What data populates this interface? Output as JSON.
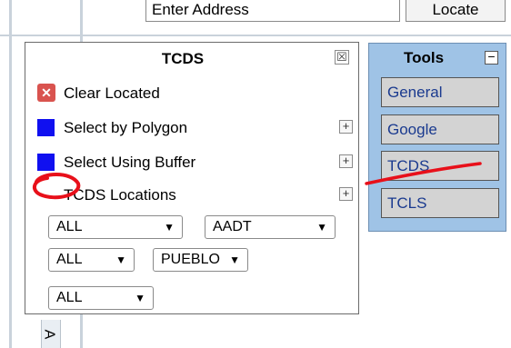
{
  "search": {
    "value": "Enter Address",
    "locate_label": "Locate"
  },
  "tcds_panel": {
    "title": "TCDS",
    "close_glyph": "☒",
    "clear_icon": "close-icon",
    "items": [
      {
        "label": "Clear Located"
      },
      {
        "label": "Select by Polygon"
      },
      {
        "label": "Select Using Buffer"
      },
      {
        "label": "TCDS Locations"
      }
    ],
    "expand_glyph": "+",
    "selects": [
      {
        "value": "ALL"
      },
      {
        "value": "AADT"
      },
      {
        "value": "ALL"
      },
      {
        "value": "PUEBLO"
      },
      {
        "value": "ALL"
      }
    ],
    "chevron": "❯"
  },
  "tools_panel": {
    "title": "Tools",
    "minimize_glyph": "−",
    "buttons": [
      {
        "label": "General"
      },
      {
        "label": "Google"
      },
      {
        "label": "TCDS"
      },
      {
        "label": "TCLS"
      }
    ]
  },
  "side_tab": {
    "label": "A"
  },
  "colors": {
    "tools_bg": "#9fc3e6",
    "select_blue": "#1010f0",
    "annotation": "#e8101a"
  }
}
